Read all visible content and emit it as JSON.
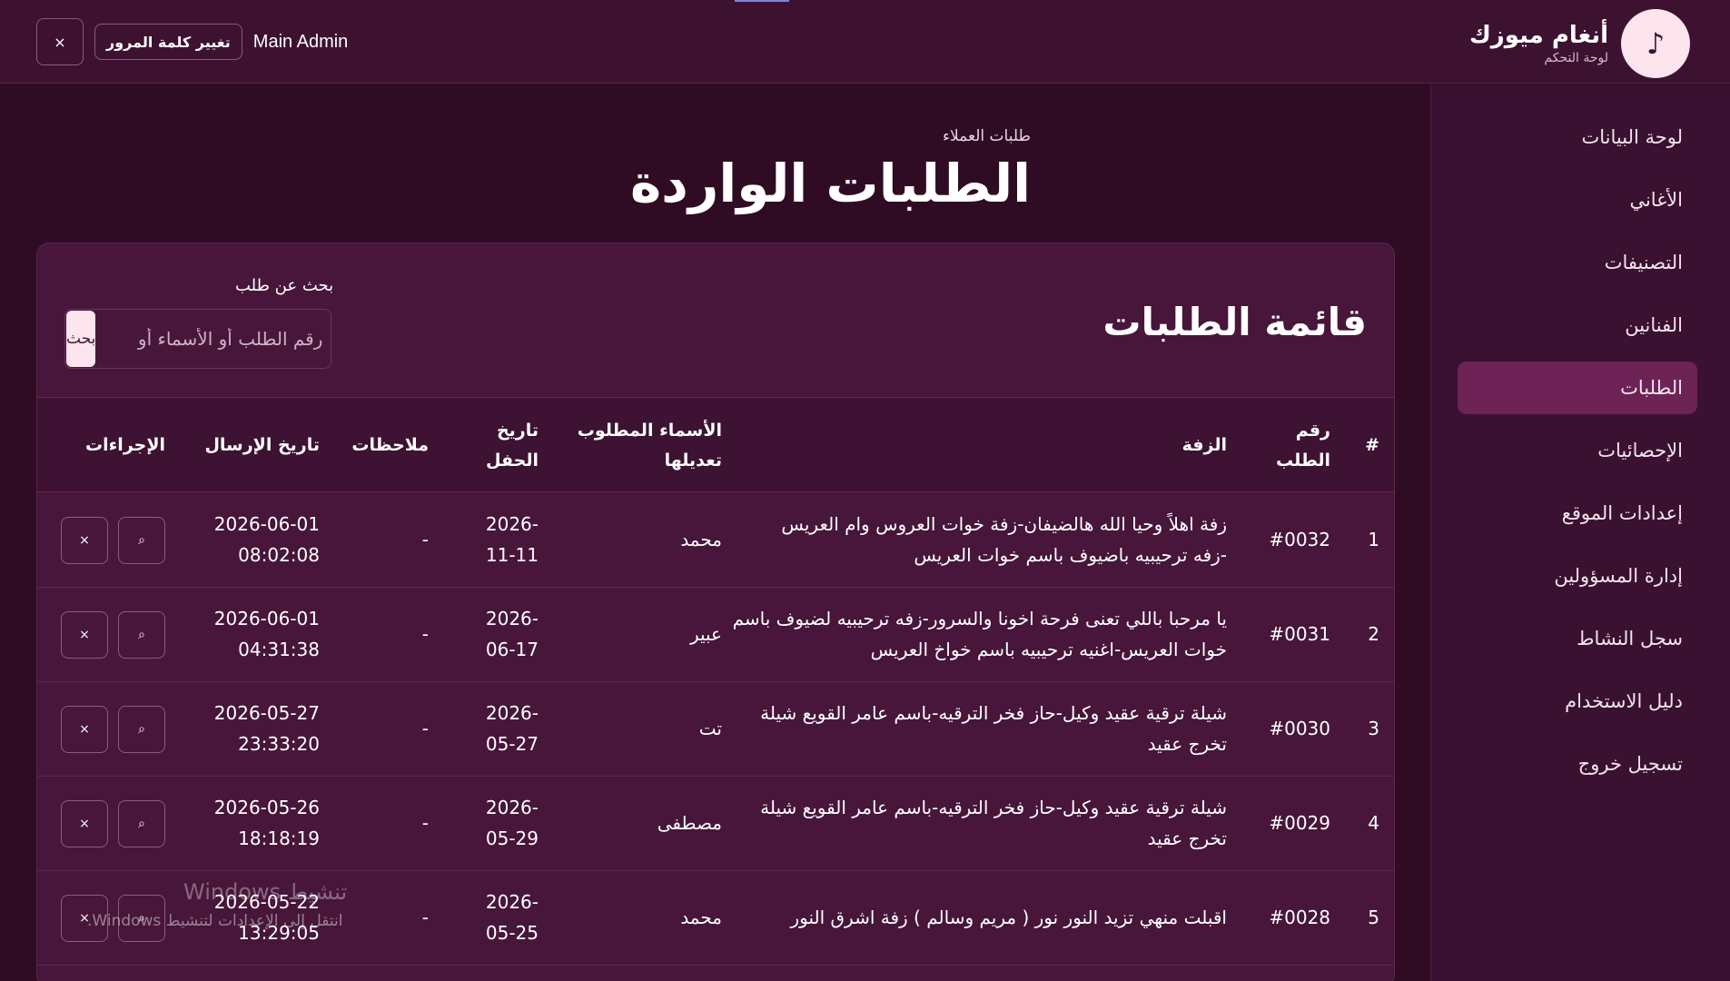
{
  "header": {
    "brand_title": "أنغام ميوزك",
    "brand_subtitle": "لوحة التحكم",
    "brand_logo_icon": "music-note-icon",
    "admin_name": "Main Admin",
    "change_password_label": "تغيير كلمة المرور",
    "close_label": "×"
  },
  "sidebar": {
    "items": [
      {
        "label": "لوحة البيانات"
      },
      {
        "label": "الأغاني"
      },
      {
        "label": "التصنيفات"
      },
      {
        "label": "الفنانين"
      },
      {
        "label": "الطلبات",
        "active": true
      },
      {
        "label": "الإحصائيات"
      },
      {
        "label": "إعدادات الموقع"
      },
      {
        "label": "إدارة المسؤولين"
      },
      {
        "label": "سجل النشاط"
      },
      {
        "label": "دليل الاستخدام"
      },
      {
        "label": "تسجيل خروج"
      }
    ]
  },
  "main": {
    "breadcrumb": "طلبات العملاء",
    "page_title": "الطلبات الواردة",
    "card_title": "قائمة الطلبات",
    "search": {
      "label": "بحث عن طلب",
      "placeholder": "رقم الطلب أو الأسماء أو",
      "button_label": "بحث"
    },
    "table": {
      "headers": {
        "index": "#",
        "order_no_1": "رقم",
        "order_no_2": "الطلب",
        "zaffa": "الزفة",
        "names_1": "الأسماء المطلوب",
        "names_2": "تعديلها",
        "party_date_1": "تاريخ",
        "party_date_2": "الحفل",
        "notes": "ملاحظات",
        "sent_date": "تاريخ الإرسال",
        "actions": "الإجراءات"
      },
      "rows": [
        {
          "index": "1",
          "order_no": "#0032",
          "zaffa_1": "زفة اهلاً وحيا الله هالضيفان-زفة خوات العروس وام العريس",
          "zaffa_2": "-زفه ترحيبيه باضيوف باسم خوات العريس",
          "names": "محمد",
          "party_date_1": "2026-",
          "party_date_2": "11-11",
          "notes": "-",
          "sent_date_1": "2026-06-01",
          "sent_date_2": "08:02:08"
        },
        {
          "index": "2",
          "order_no": "#0031",
          "zaffa_1": "يا مرحبا باللي تعنى فرحة اخونا والسرور-زفه ترحيبيه لضيوف باسم",
          "zaffa_2": "خوات العريس-اغنيه ترحيبيه باسم خواخ العريس",
          "names": "عبير",
          "party_date_1": "2026-",
          "party_date_2": "06-17",
          "notes": "-",
          "sent_date_1": "2026-06-01",
          "sent_date_2": "04:31:38"
        },
        {
          "index": "3",
          "order_no": "#0030",
          "zaffa_1": "شيلة ترقية عقيد وكيل-حاز فخر الترقيه-باسم عامر القويع شيلة",
          "zaffa_2": "تخرج عقيد",
          "names": "تت",
          "party_date_1": "2026-",
          "party_date_2": "05-27",
          "notes": "-",
          "sent_date_1": "2026-05-27",
          "sent_date_2": "23:33:20"
        },
        {
          "index": "4",
          "order_no": "#0029",
          "zaffa_1": "شيلة ترقية عقيد وكيل-حاز فخر الترقيه-باسم عامر القويع شيلة",
          "zaffa_2": "تخرج عقيد",
          "names": "مصطفى",
          "party_date_1": "2026-",
          "party_date_2": "05-29",
          "notes": "-",
          "sent_date_1": "2026-05-26",
          "sent_date_2": "18:18:19"
        },
        {
          "index": "5",
          "order_no": "#0028",
          "zaffa_1": "اقبلت منهي تزيد النور نور ( مريم وسالم ) زفة اشرق النور",
          "zaffa_2": "",
          "names": "محمد",
          "party_date_1": "2026-",
          "party_date_2": "05-25",
          "notes": "-",
          "sent_date_1": "2026-05-22",
          "sent_date_2": "13:29:05"
        }
      ],
      "view_icon": "view-icon",
      "delete_icon": "×"
    }
  },
  "watermark": {
    "title": "تنشيط Windows",
    "subtitle": "انتقل إلى الإعدادات لتنشيط Windows."
  },
  "colors": {
    "background": "#2f0c23",
    "header": "#3d1230",
    "card": "#47163a",
    "active_item": "#6d2356",
    "accent_light": "#fde5ee"
  }
}
